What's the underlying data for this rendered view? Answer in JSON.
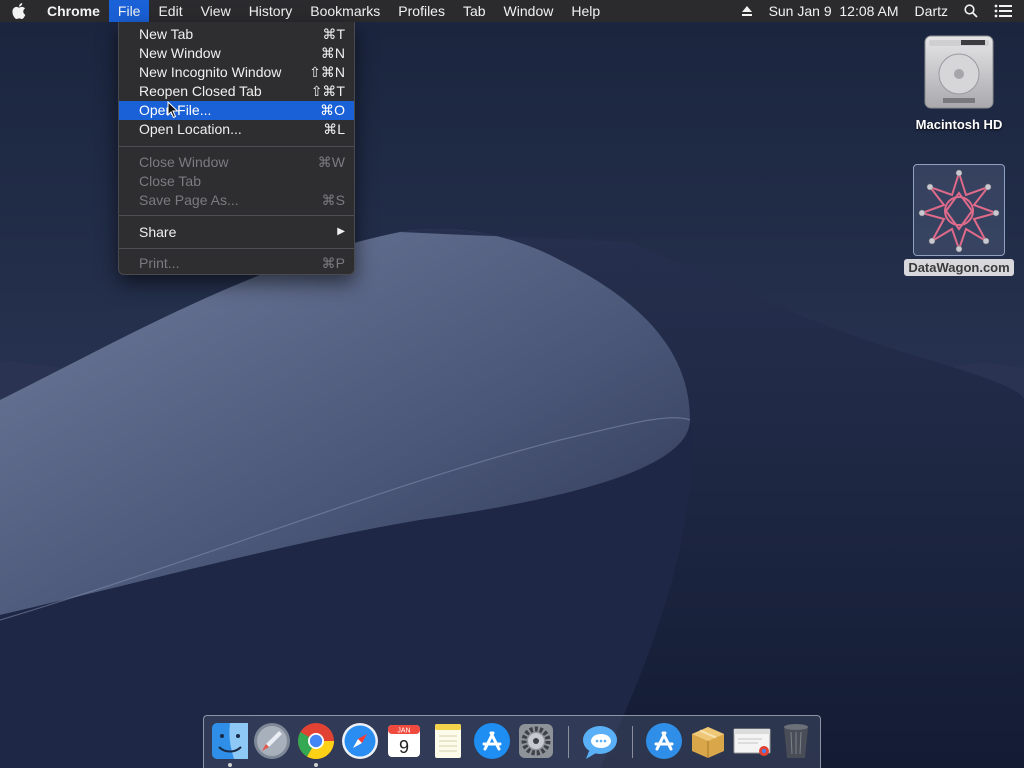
{
  "menubar": {
    "apple_icon": "apple-logo-icon",
    "app_name": "Chrome",
    "menus": [
      "File",
      "Edit",
      "View",
      "History",
      "Bookmarks",
      "Profiles",
      "Tab",
      "Window",
      "Help"
    ],
    "active_menu": "File",
    "status": {
      "eject_icon": "eject-icon",
      "datetime": "Sun Jan 9  12:08 AM",
      "user": "Dartz",
      "search_icon": "spotlight-search-icon",
      "notification_icon": "notification-center-icon"
    }
  },
  "file_menu": {
    "groups": [
      [
        {
          "label": "New Tab",
          "shortcut": "⌘T",
          "enabled": true
        },
        {
          "label": "New Window",
          "shortcut": "⌘N",
          "enabled": true
        },
        {
          "label": "New Incognito Window",
          "shortcut": "⇧⌘N",
          "enabled": true
        },
        {
          "label": "Reopen Closed Tab",
          "shortcut": "⇧⌘T",
          "enabled": true
        },
        {
          "label": "Open File...",
          "shortcut": "⌘O",
          "enabled": true,
          "highlighted": true
        },
        {
          "label": "Open Location...",
          "shortcut": "⌘L",
          "enabled": true
        }
      ],
      [
        {
          "label": "Close Window",
          "shortcut": "⌘W",
          "enabled": false
        },
        {
          "label": "Close Tab",
          "shortcut": "",
          "enabled": false
        },
        {
          "label": "Save Page As...",
          "shortcut": "⌘S",
          "enabled": false
        }
      ],
      [
        {
          "label": "Share",
          "shortcut": "▶",
          "enabled": true,
          "submenu": true
        }
      ],
      [
        {
          "label": "Print...",
          "shortcut": "⌘P",
          "enabled": false
        }
      ]
    ]
  },
  "desktop_icons": [
    {
      "label": "Macintosh HD",
      "icon": "hard-drive-icon"
    },
    {
      "label": "DataWagon.com",
      "icon": "datawagon-folder-icon"
    }
  ],
  "dock": {
    "apps": [
      {
        "name": "Finder",
        "icon": "finder-icon",
        "running": true
      },
      {
        "name": "Launchpad",
        "icon": "launchpad-icon",
        "running": false
      },
      {
        "name": "Chrome",
        "icon": "chrome-icon",
        "running": true
      },
      {
        "name": "Safari",
        "icon": "safari-icon",
        "running": false
      },
      {
        "name": "Calendar",
        "icon": "calendar-icon",
        "running": false,
        "month": "JAN",
        "day": "9"
      },
      {
        "name": "Notes",
        "icon": "notes-icon",
        "running": false
      },
      {
        "name": "App Store",
        "icon": "app-store-icon",
        "running": false
      },
      {
        "name": "System Preferences",
        "icon": "system-preferences-icon",
        "running": false
      },
      {
        "name": "Messages",
        "icon": "messages-icon",
        "running": false
      },
      {
        "name": "Applications",
        "icon": "applications-folder-icon",
        "running": false
      },
      {
        "name": "Package",
        "icon": "package-icon",
        "running": false
      },
      {
        "name": "Chrome Window",
        "icon": "chrome-window-thumbnail-icon",
        "running": false
      },
      {
        "name": "Trash",
        "icon": "trash-icon",
        "running": false
      }
    ]
  },
  "colors": {
    "menubar_bg": "#2b2b2e",
    "menu_bg": "#2e2e30",
    "highlight": "#1a60d6",
    "disabled_text": "#7b7b80",
    "wallpaper_sky": "#1b2540"
  }
}
